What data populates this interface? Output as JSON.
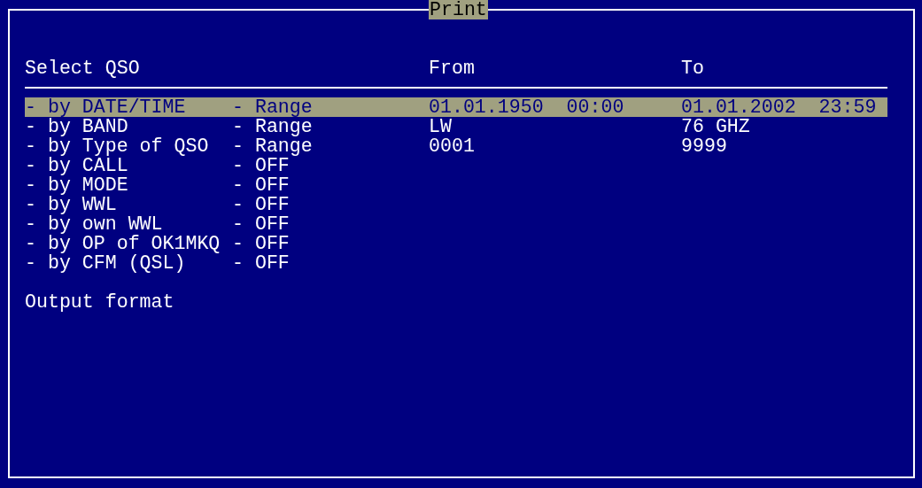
{
  "window": {
    "title": "Print"
  },
  "header": {
    "select": "Select QSO",
    "from": "From",
    "to": "To"
  },
  "rows": [
    {
      "criterion": "- by DATE/TIME",
      "mode": "- Range",
      "from": "01.01.1950",
      "from_time": "00:00",
      "to": "01.01.2002",
      "to_time": "23:59",
      "selected": true
    },
    {
      "criterion": "- by BAND",
      "mode": "- Range",
      "from": "LW",
      "to": "76 GHZ",
      "selected": false
    },
    {
      "criterion": "- by Type of QSO",
      "mode": "- Range",
      "from": "0001",
      "to": "9999",
      "selected": false
    },
    {
      "criterion": "- by CALL",
      "mode": "- OFF",
      "selected": false
    },
    {
      "criterion": "- by MODE",
      "mode": "- OFF",
      "selected": false
    },
    {
      "criterion": "- by WWL",
      "mode": "- OFF",
      "selected": false
    },
    {
      "criterion": "- by own WWL",
      "mode": "- OFF",
      "selected": false
    },
    {
      "criterion": "- by OP of OK1MKQ",
      "mode": "- OFF",
      "selected": false
    },
    {
      "criterion": "- by CFM (QSL)",
      "mode": "- OFF",
      "selected": false
    }
  ],
  "output_format": {
    "label": "Output format"
  }
}
